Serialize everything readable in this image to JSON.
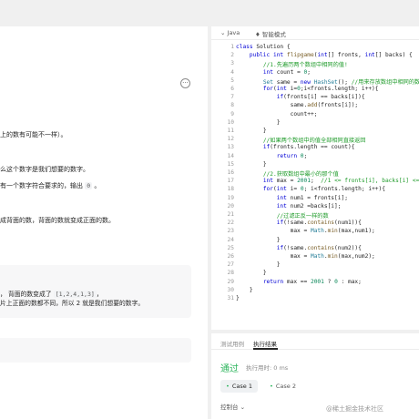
{
  "problem": {
    "line1": "上的数有可能不一样）。",
    "line2": "么这个数字是我们想要的数字。",
    "line3_pre": "有一个数字符合要求的，输出",
    "line3_code": "0",
    "line3_post": "。",
    "line4": "成背面的数，背面的数就变成正面的数。",
    "example_line1_pre": "，  背面的数变成了",
    "example_line1_code": "[1,2,4,1,3]",
    "example_line1_post": "，",
    "example_line2": "片上正面的数都不同，所以 2 就是我们想要的数字。",
    "more_icon": "more-horizontal-icon",
    "more_glyph": "···"
  },
  "editor": {
    "language": "Java",
    "language_caret": "⌄",
    "mode_icon": "smart-mode-icon",
    "mode_glyph": "♦",
    "mode_label": "智能模式",
    "lines": [
      {
        "n": "1",
        "indent": "",
        "parts": [
          [
            "kw",
            "class "
          ],
          [
            "",
            "Solution {"
          ]
        ]
      },
      {
        "n": "2",
        "indent": "    ",
        "parts": [
          [
            "kw",
            "public int "
          ],
          [
            "fn",
            "flipgame"
          ],
          [
            "",
            "("
          ],
          [
            "kw",
            "int"
          ],
          [
            "",
            "[] fronts, "
          ],
          [
            "kw",
            "int"
          ],
          [
            "",
            "[] backs) {"
          ]
        ]
      },
      {
        "n": "3",
        "indent": "        ",
        "parts": [
          [
            "cm",
            "//1.先遍历两个数组中相同的值!"
          ]
        ]
      },
      {
        "n": "4",
        "indent": "        ",
        "parts": [
          [
            "kw",
            "int "
          ],
          [
            "",
            "count = "
          ],
          [
            "num",
            "0"
          ],
          [
            "",
            ";"
          ]
        ]
      },
      {
        "n": "5",
        "indent": "        ",
        "parts": [
          [
            "ty",
            "Set "
          ],
          [
            "",
            "same = "
          ],
          [
            "kw",
            "new "
          ],
          [
            "ty",
            "HashSet"
          ],
          [
            "",
            "(); "
          ],
          [
            "cm",
            "//用来存放数组中相同的数"
          ]
        ]
      },
      {
        "n": "6",
        "indent": "        ",
        "parts": [
          [
            "kw",
            "for"
          ],
          [
            "",
            "("
          ],
          [
            "kw",
            "int "
          ],
          [
            "",
            "i="
          ],
          [
            "num",
            "0"
          ],
          [
            "",
            ";i<fronts.length; i++){"
          ]
        ]
      },
      {
        "n": "7",
        "indent": "            ",
        "parts": [
          [
            "kw",
            "if"
          ],
          [
            "",
            "(fronts[i] == backs[i]){"
          ]
        ]
      },
      {
        "n": "8",
        "indent": "                ",
        "parts": [
          [
            "",
            "same."
          ],
          [
            "fn",
            "add"
          ],
          [
            "",
            "(fronts[i]);"
          ]
        ]
      },
      {
        "n": "9",
        "indent": "                ",
        "parts": [
          [
            "",
            "count++;"
          ]
        ]
      },
      {
        "n": "10",
        "indent": "            ",
        "parts": [
          [
            "",
            "}"
          ]
        ]
      },
      {
        "n": "11",
        "indent": "        ",
        "parts": [
          [
            "",
            "}"
          ]
        ]
      },
      {
        "n": "12",
        "indent": "        ",
        "parts": [
          [
            "cm",
            "//如果两个数组中的值全部相同直接返回"
          ]
        ]
      },
      {
        "n": "13",
        "indent": "        ",
        "parts": [
          [
            "kw",
            "if"
          ],
          [
            "",
            "(fronts.length == count){"
          ]
        ]
      },
      {
        "n": "14",
        "indent": "            ",
        "parts": [
          [
            "kw",
            "return "
          ],
          [
            "num",
            "0"
          ],
          [
            "",
            ";"
          ]
        ]
      },
      {
        "n": "15",
        "indent": "        ",
        "parts": [
          [
            "",
            "}"
          ]
        ]
      },
      {
        "n": "16",
        "indent": "        ",
        "parts": [
          [
            "cm",
            "//2.获取数组中最小的那个值"
          ]
        ]
      },
      {
        "n": "17",
        "indent": "        ",
        "parts": [
          [
            "kw",
            "int "
          ],
          [
            "",
            "max = "
          ],
          [
            "num",
            "2001"
          ],
          [
            "",
            ";  "
          ],
          [
            "cm",
            "//1 <= fronts[i], backs[i] <= 2000"
          ]
        ]
      },
      {
        "n": "18",
        "indent": "        ",
        "parts": [
          [
            "kw",
            "for"
          ],
          [
            "",
            "("
          ],
          [
            "kw",
            "int "
          ],
          [
            "",
            "i= "
          ],
          [
            "num",
            "0"
          ],
          [
            "",
            "; i<fronts.length; i++){"
          ]
        ]
      },
      {
        "n": "19",
        "indent": "            ",
        "parts": [
          [
            "kw",
            "int "
          ],
          [
            "",
            "num1 = fronts[i];"
          ]
        ]
      },
      {
        "n": "20",
        "indent": "            ",
        "parts": [
          [
            "kw",
            "int "
          ],
          [
            "",
            "num2 =backs[i];"
          ]
        ]
      },
      {
        "n": "21",
        "indent": "            ",
        "parts": [
          [
            "cm",
            "//过滤正反一样的数"
          ]
        ]
      },
      {
        "n": "22",
        "indent": "            ",
        "parts": [
          [
            "kw",
            "if"
          ],
          [
            "",
            "(!same."
          ],
          [
            "fn",
            "contains"
          ],
          [
            "",
            "(num1)){"
          ]
        ]
      },
      {
        "n": "23",
        "indent": "                ",
        "parts": [
          [
            "",
            "max = "
          ],
          [
            "ty",
            "Math"
          ],
          [
            "",
            "."
          ],
          [
            "fn",
            "min"
          ],
          [
            "",
            "(max,num1);"
          ]
        ]
      },
      {
        "n": "24",
        "indent": "            ",
        "parts": [
          [
            "",
            "}"
          ]
        ]
      },
      {
        "n": "25",
        "indent": "            ",
        "parts": [
          [
            "kw",
            "if"
          ],
          [
            "",
            "(!same."
          ],
          [
            "fn",
            "contains"
          ],
          [
            "",
            "(num2)){"
          ]
        ]
      },
      {
        "n": "26",
        "indent": "                ",
        "parts": [
          [
            "",
            "max = "
          ],
          [
            "ty",
            "Math"
          ],
          [
            "",
            "."
          ],
          [
            "fn",
            "min"
          ],
          [
            "",
            "(max,num2);"
          ]
        ]
      },
      {
        "n": "27",
        "indent": "            ",
        "parts": [
          [
            "",
            "}"
          ]
        ]
      },
      {
        "n": "28",
        "indent": "        ",
        "parts": [
          [
            "",
            "}"
          ]
        ]
      },
      {
        "n": "29",
        "indent": "        ",
        "parts": [
          [
            "kw",
            "return "
          ],
          [
            "",
            "max == "
          ],
          [
            "num",
            "2001"
          ],
          [
            "",
            " ? "
          ],
          [
            "num",
            "0"
          ],
          [
            "",
            " : max;"
          ]
        ]
      },
      {
        "n": "30",
        "indent": "    ",
        "parts": [
          [
            "",
            "}"
          ]
        ]
      },
      {
        "n": "31",
        "indent": "",
        "parts": [
          [
            "",
            "}"
          ]
        ]
      }
    ]
  },
  "results": {
    "tab_testcase": "测试用例",
    "tab_result": "执行结果",
    "status": "通过",
    "time_label": "执行用时: 0 ms",
    "case1": "Case 1",
    "case2": "Case 2",
    "case_dot": "•",
    "console": "控制台",
    "console_caret": "⌄",
    "status_color": "#2db55d"
  },
  "watermark": "@稀土掘金技术社区"
}
